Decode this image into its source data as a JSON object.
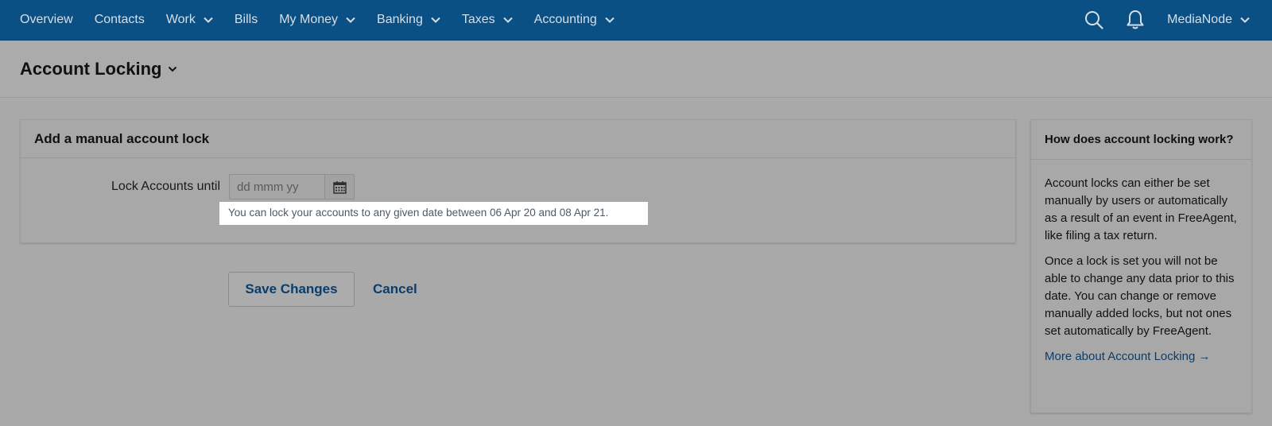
{
  "nav": {
    "items": [
      {
        "label": "Overview",
        "dropdown": false
      },
      {
        "label": "Contacts",
        "dropdown": false
      },
      {
        "label": "Work",
        "dropdown": true
      },
      {
        "label": "Bills",
        "dropdown": false
      },
      {
        "label": "My Money",
        "dropdown": true
      },
      {
        "label": "Banking",
        "dropdown": true
      },
      {
        "label": "Taxes",
        "dropdown": true
      },
      {
        "label": "Accounting",
        "dropdown": true
      }
    ],
    "user_label": "MediaNode",
    "icons": [
      "search-icon",
      "bell-icon"
    ]
  },
  "header": {
    "title": "Account Locking"
  },
  "panel": {
    "title": "Add a manual account lock",
    "field_label": "Lock Accounts until",
    "date_placeholder": "dd mmm yy",
    "date_value": "",
    "hint": "You can lock your accounts to any given date between 06 Apr 20 and 08 Apr 21."
  },
  "actions": {
    "save_label": "Save Changes",
    "cancel_label": "Cancel"
  },
  "help": {
    "title": "How does account locking work?",
    "para1": "Account locks can either be set manually by users or automatically as a result of an event in FreeAgent, like filing a tax return.",
    "para2": "Once a lock is set you will not be able to change any data prior to this date. You can change or remove manually added locks, but not ones set automatically by FreeAgent.",
    "link": "More about Account Locking →"
  },
  "colors": {
    "nav_bg": "#0a5084",
    "link": "#0b3d6b",
    "overlay_bg": "#a9a9a9"
  }
}
